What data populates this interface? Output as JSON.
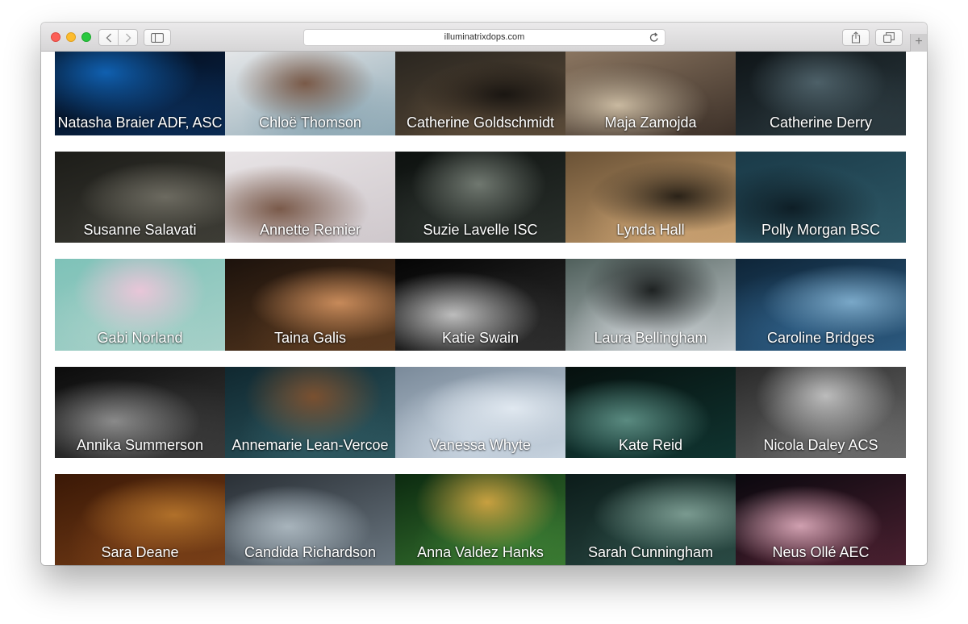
{
  "browser": {
    "address": "illuminatrixdops.com",
    "icons": [
      "back-arrow-icon",
      "forward-arrow-icon",
      "sidebar-icon",
      "reload-icon",
      "share-icon",
      "tabs-icon",
      "plus-icon"
    ]
  },
  "gallery": {
    "rows": [
      [
        "Natasha Braier ADF, ASC",
        "Chloë Thomson",
        "Catherine Goldschmidt",
        "Maja Zamojda",
        "Catherine Derry"
      ],
      [
        "Susanne Salavati",
        "Annette Remier",
        "Suzie Lavelle ISC",
        "Lynda Hall",
        "Polly Morgan BSC"
      ],
      [
        "Gabi Norland",
        "Taina Galis",
        "Katie Swain",
        "Laura Bellingham",
        "Caroline Bridges"
      ],
      [
        "Annika Summerson",
        "Annemarie Lean-Vercoe",
        "Vanessa Whyte",
        "Kate Reid",
        "Nicola Daley ACS"
      ],
      [
        "Sara Deane",
        "Candida Richardson",
        "Anna Valdez Hanks",
        "Sarah Cunningham",
        "Neus Ollé AEC"
      ]
    ]
  }
}
